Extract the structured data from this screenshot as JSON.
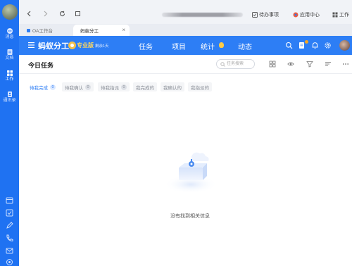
{
  "rail": {
    "items": [
      {
        "label": "消息",
        "icon": "message-icon"
      },
      {
        "label": "文档",
        "icon": "document-icon"
      },
      {
        "label": "工作",
        "icon": "grid-icon"
      },
      {
        "label": "通讯录",
        "icon": "contacts-icon"
      }
    ],
    "active_index": 2,
    "bottom_icons": [
      "calendar-icon",
      "checklist-icon",
      "pen-icon",
      "phone-icon",
      "mail-icon",
      "settings-icon"
    ]
  },
  "browser": {
    "bookmarks": [
      {
        "label": "待办事项",
        "icon": "todo-icon"
      },
      {
        "label": "应用中心",
        "icon": "app-center-icon"
      },
      {
        "label": "工作",
        "icon": "work-icon"
      }
    ],
    "tabs": [
      {
        "label": "OA工作台",
        "active": false
      },
      {
        "label": "蚂蚁分工",
        "active": true
      }
    ]
  },
  "app": {
    "brand": "蚂蚁分工",
    "edition": "专业版",
    "trial": "剩余1天",
    "nav": [
      "任务",
      "项目",
      "统计",
      "动态"
    ]
  },
  "page": {
    "title": "今日任务",
    "search_placeholder": "任务搜索"
  },
  "filter_tabs": [
    {
      "label": "待我完成",
      "count": "0",
      "active": true
    },
    {
      "label": "待我确认",
      "count": "0",
      "active": false
    },
    {
      "label": "待我指派",
      "count": "0",
      "active": false
    },
    {
      "label": "我完成的",
      "count": null,
      "active": false
    },
    {
      "label": "我确认的",
      "count": null,
      "active": false
    },
    {
      "label": "我指派的",
      "count": null,
      "active": false
    }
  ],
  "empty_state": {
    "message": "没有找到相关信息"
  },
  "colors": {
    "rail": "#1f72f2",
    "header": "#2d7ef5",
    "accent": "#2d7ef5",
    "pro": "#ffd75e"
  }
}
